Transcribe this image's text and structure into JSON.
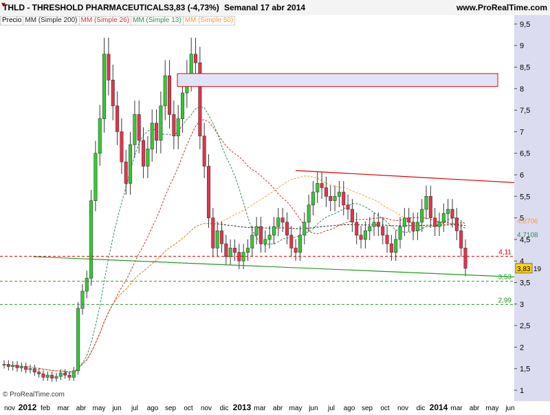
{
  "header": {
    "title": "THLD - THRESHOLD PHARMACEUTICALS",
    "quote": "3,83 (-4,73%)",
    "period": "Semanal  17 abr 2014",
    "site": "www.ProRealTime.com"
  },
  "legend": {
    "price": "Precio",
    "ma200": "MM (Simple 200)",
    "ma26": "MM (Simple 26)",
    "ma13": "MM (Simple 13)",
    "ma50": "MM (Simple 50)"
  },
  "copyright": "© ProRealTime.com",
  "colors": {
    "up": "#33cc33",
    "down": "#e8334a",
    "ma200": "#222222",
    "ma26": "#cc3333",
    "ma13": "#2e8b57",
    "ma50": "#ff9933",
    "resistance": "#e00000",
    "support": "#229922",
    "axis_bg": "#dcdcf0"
  },
  "chart_data": {
    "type": "candlestick",
    "y_ticks": [
      1,
      1.5,
      2,
      2.5,
      3,
      3.5,
      4,
      4.5,
      5,
      5.5,
      6,
      6.5,
      7,
      7.5,
      8,
      8.5,
      9,
      9.5
    ],
    "y_tick_labels": [
      "1",
      "1,5",
      "2",
      "2,5",
      "3",
      "3,5",
      "4",
      "4,5",
      "5",
      "5,5",
      "6",
      "6,5",
      "7",
      "7,5",
      "8",
      "8,5",
      "9",
      "9,5"
    ],
    "x_labels": [
      "nov",
      "2012",
      "feb",
      "mar",
      "abr",
      "may",
      "jun",
      "jul",
      "ago",
      "sep",
      "oct",
      "nov",
      "dic",
      "2013",
      "mar",
      "abr",
      "may",
      "jun",
      "jul",
      "ago",
      "sep",
      "oct",
      "nov",
      "dic",
      "2014",
      "mar",
      "abr",
      "may",
      "jun"
    ],
    "x_bold": [
      "2012",
      "2013",
      "2014"
    ],
    "closes": [
      1.6,
      1.55,
      1.58,
      1.52,
      1.55,
      1.48,
      1.5,
      1.42,
      1.38,
      1.3,
      1.35,
      1.28,
      1.32,
      1.4,
      1.35,
      1.3,
      1.45,
      2.9,
      3.3,
      3.6,
      5.4,
      6.5,
      7.3,
      8.8,
      8.2,
      7.6,
      7.0,
      6.3,
      5.8,
      6.7,
      7.4,
      6.8,
      6.2,
      6.6,
      7.2,
      6.8,
      7.6,
      8.3,
      7.4,
      6.9,
      7.3,
      7.9,
      8.3,
      8.8,
      8.6,
      6.9,
      6.2,
      5.0,
      4.3,
      4.7,
      4.4,
      4.1,
      4.3,
      4.2,
      4.0,
      4.2,
      4.3,
      4.6,
      4.8,
      4.4,
      4.5,
      4.6,
      4.8,
      5.0,
      4.9,
      4.6,
      4.3,
      4.2,
      4.6,
      4.9,
      5.3,
      5.6,
      5.8,
      5.7,
      5.5,
      5.4,
      5.5,
      5.6,
      5.3,
      5.2,
      4.9,
      4.6,
      4.5,
      4.7,
      4.8,
      4.9,
      4.8,
      4.6,
      4.4,
      4.2,
      4.5,
      4.8,
      5.0,
      4.9,
      4.7,
      4.9,
      5.2,
      5.5,
      5.0,
      4.8,
      4.9,
      5.1,
      5.2,
      5.0,
      4.7,
      4.3,
      3.83
    ],
    "annotations": {
      "resistance_box": {
        "from": 8.05,
        "to": 8.35
      },
      "resistance_line": {
        "start": 6.1,
        "end": 5.82
      },
      "support_line": {
        "start": 4.1,
        "end": 3.63
      },
      "levels": [
        {
          "value": 4.11,
          "label": "4,11",
          "color": "#e00000"
        },
        {
          "value": 3.53,
          "label": "3,53",
          "color": "#229922"
        },
        {
          "value": 2.99,
          "label": "2,99",
          "color": "#229922"
        }
      ],
      "price_labels": [
        {
          "value": 4.8706,
          "label": "4,8706",
          "color": "#ff9933"
        },
        {
          "value": 4.7108,
          "label": "4,7108",
          "color": "#2e8b57"
        },
        {
          "value": 3.83,
          "label": "3,83",
          "color": "#000000"
        },
        {
          "value": 3.83,
          "label": "19",
          "color": "#000000"
        }
      ]
    }
  }
}
